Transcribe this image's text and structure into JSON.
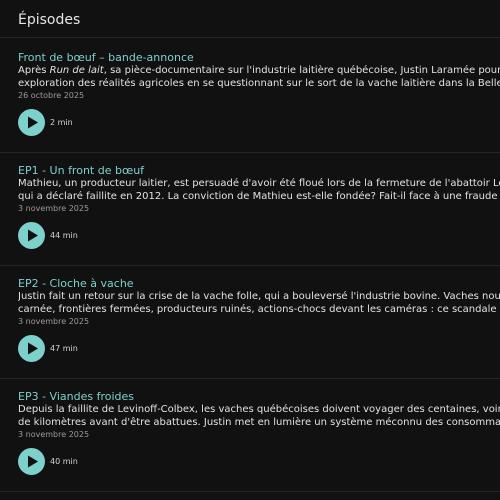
{
  "section": {
    "title": "Épisodes"
  },
  "episodes": [
    {
      "title": "Front de bœuf – bande-annonce",
      "description_line1_prefix": "Après ",
      "description_line1_italic": "Run de lait",
      "description_line1_suffix": ", sa pièce-documentaire sur l'industrie laitière québécoise, Justin Laramée poursuit",
      "description_line2": "exploration des réalités agricoles en se questionnant sur le sort de la vache laitière dans la Belle Pro",
      "date": "26 octobre 2025",
      "duration": "2 min",
      "play_icon": "play-icon"
    },
    {
      "title": "EP1 - Un front de bœuf",
      "description_line1": "Mathieu, un producteur laitier, est persuadé d'avoir été floué lors de la fermeture de l'abattoir Levino",
      "description_line2": "qui a déclaré faillite en 2012. La conviction de Mathieu est-elle fondée? Fait-il face à une fraude orga",
      "date": "3 novembre 2025",
      "duration": "44 min",
      "play_icon": "play-icon"
    },
    {
      "title": "EP2 - Cloche à vache",
      "description_line1": "Justin fait un retour sur la crise de la vache folle, qui a bouleversé l'industrie bovine. Vaches nourries",
      "description_line2": "carnée, frontières fermées, producteurs ruinés, actions-chocs devant les caméras : ce scandale plane",
      "date": "3 novembre 2025",
      "duration": "47 min",
      "play_icon": "play-icon"
    },
    {
      "title": "EP3 - Viandes froides",
      "description_line1": "Depuis la faillite de Levinoff-Colbex, les vaches québécoises doivent voyager des centaines, voire des",
      "description_line2": "de kilomètres avant d'être abattues. Justin met en lumière un système méconnu des consommateur",
      "date": "3 novembre 2025",
      "duration": "40 min",
      "play_icon": "play-icon"
    }
  ],
  "colors": {
    "background": "#111111",
    "accent": "#7ed0cc",
    "text": "#e3e3e3",
    "muted": "#9a9a9a"
  }
}
